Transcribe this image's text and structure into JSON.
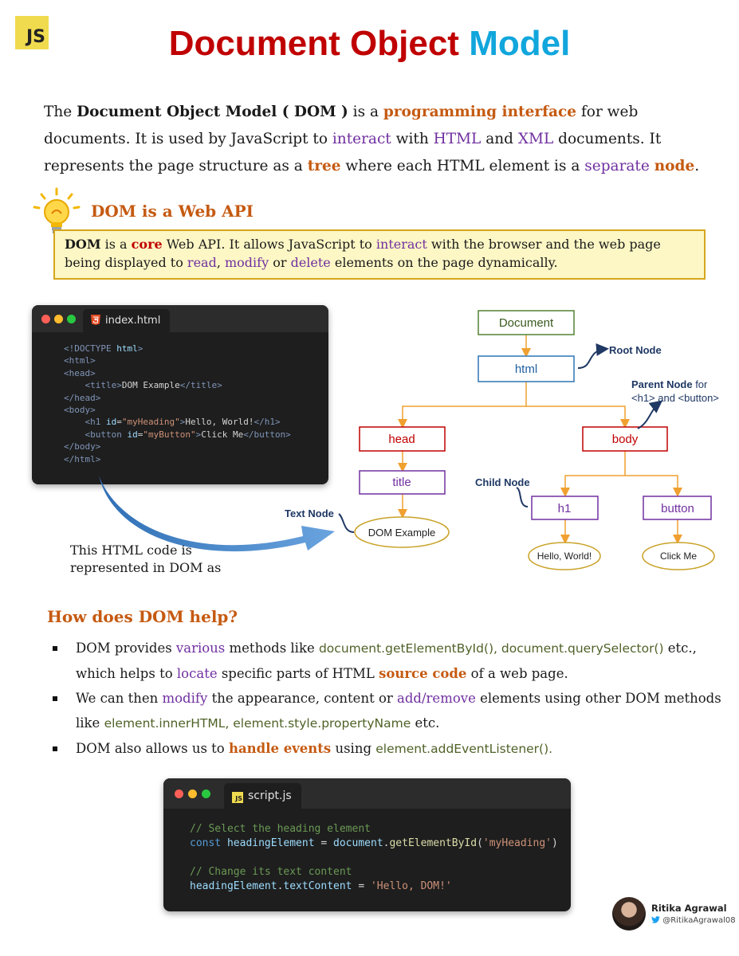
{
  "badge": "JS",
  "title": {
    "part1": "Document Object",
    "part2": "Model"
  },
  "intro": {
    "s1": "The ",
    "dom_bold": "Document Object Model ( DOM )",
    "s2": " is a ",
    "prog_iface": "programming interface",
    "s3": " for web documents. It is used by JavaScript to ",
    "interact": "interact",
    "s4": " with ",
    "html": "HTML",
    "s5": " and ",
    "xml": "XML",
    "s6": " documents. It represents the page structure as a ",
    "tree": "tree",
    "s7": " where each HTML element is a ",
    "separate": "separate",
    "s8": " ",
    "node": "node",
    "s9": "."
  },
  "web_api": {
    "heading": "DOM is a Web API",
    "b1": "DOM",
    "t1": " is a ",
    "core": "core",
    "t2": " Web API. It allows JavaScript to ",
    "interact": "interact",
    "t3": " with the browser and the web page being displayed to ",
    "read": "read",
    "t4": ", ",
    "modify": "modify",
    "t5": " or ",
    "delete": "delete",
    "t6": " elements on the page dynamically."
  },
  "html_window": {
    "filename": "index.html"
  },
  "caption": {
    "line1": "This HTML code is",
    "line2": "represented in DOM as"
  },
  "tree": {
    "document": "Document",
    "html": "html",
    "head": "head",
    "body": "body",
    "title": "title",
    "dom_example": "DOM Example",
    "h1": "h1",
    "button": "button",
    "hello_world": "Hello, World!",
    "click_me": "Click Me",
    "root_node": "Root Node",
    "parent_node": "Parent Node",
    "parent_for": " for",
    "parent_line2": "<h1> and <button>",
    "child_node": "Child Node",
    "text_node": "Text Node"
  },
  "help": {
    "heading": "How does DOM help?",
    "b1_s1": "DOM provides ",
    "b1_various": "various",
    "b1_s2": " methods like ",
    "b1_methods": "document.getElementById(), document.querySelector()",
    "b1_s3": " etc., which helps to ",
    "b1_locate": "locate",
    "b1_s4": " specific parts of HTML ",
    "b1_source": "source code",
    "b1_s5": " of a web page.",
    "b2_s1": "We can then ",
    "b2_modify": "modify",
    "b2_s2": " the appearance, content or ",
    "b2_addremove": "add/remove",
    "b2_s3": " elements using other DOM methods like ",
    "b2_methods": "element.innerHTML, element.style.propertyName",
    "b2_s4": " etc.",
    "b3_s1": "DOM also allows us to ",
    "b3_handle": "handle events",
    "b3_s2": " using ",
    "b3_method": "element.addEventListener()."
  },
  "script_window": {
    "badge": "JS",
    "filename": "script.js",
    "comment1": "// Select the heading element",
    "kw_const": "const",
    "var1": "headingElement",
    "op_eq": " = ",
    "doc": "document",
    "dot": ".",
    "method": "getElementById",
    "lp": "(",
    "arg": "'myHeading'",
    "rp": ")",
    "comment2": "// Change its text content",
    "var2": "headingElement",
    "prop": "textContent",
    "val": "'Hello, DOM!'"
  },
  "author": {
    "name": "Ritika Agrawal",
    "handle": "@RitikaAgrawal08"
  },
  "colors": {
    "accent_red": "#c00000",
    "accent_blue": "#11a6dc",
    "orange": "#c55a11",
    "purple": "#7030a0",
    "green": "#4f6228"
  }
}
